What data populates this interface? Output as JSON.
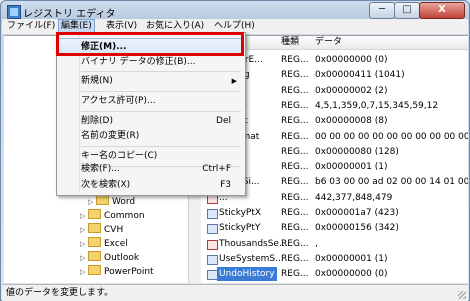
{
  "window": {
    "title": "レジストリ エディタ",
    "min_label": "─",
    "max_label": "□",
    "close_label": "X"
  },
  "menubar": {
    "items": [
      "ファイル(F)",
      "編集(E)",
      "表示(V)",
      "お気に入り(A)",
      "ヘルプ(H)"
    ]
  },
  "tree": {
    "items": [
      {
        "label": "Word",
        "expander": "▷"
      },
      {
        "label": "Common",
        "expander": "▷"
      },
      {
        "label": "CVH",
        "expander": "▷"
      },
      {
        "label": "Excel",
        "expander": "▷"
      },
      {
        "label": "Outlook",
        "expander": "▷"
      },
      {
        "label": "PowerPoint",
        "expander": "▷"
      }
    ]
  },
  "list": {
    "headers": {
      "name": "",
      "type": "種類",
      "data": "データ"
    },
    "rows": [
      {
        "name": "...aBarE...",
        "type": "REG...",
        "data": "0x00000000 (0)",
        "icon": "binary-value-icon"
      },
      {
        "name": "...Lang",
        "type": "REG...",
        "data": "0x00000411 (1041)",
        "icon": "binary-value-icon"
      },
      {
        "name": "...zed",
        "type": "REG...",
        "data": "0x00000002 (2)",
        "icon": "binary-value-icon"
      },
      {
        "name": "...ncs",
        "type": "REG...",
        "data": "4,5,1,359,0,7,15,345,59,12",
        "icon": "string-value-icon"
      },
      {
        "name": "...Cust",
        "type": "REG...",
        "data": "0x00000008 (8)",
        "icon": "binary-value-icon"
      },
      {
        "name": "...Format",
        "type": "REG...",
        "data": "00 00 00 00 00 00 00 00 00 00 00 00 00",
        "icon": "binary-value-icon"
      },
      {
        "name": "...S",
        "type": "REG...",
        "data": "0x00000080 (128)",
        "icon": "binary-value-icon"
      },
      {
        "name": "...95",
        "type": "REG...",
        "data": "0x00000001 (1)",
        "icon": "binary-value-icon"
      },
      {
        "name": "...DlgSi...",
        "type": "REG...",
        "data": "b6 03 00 00 ad 02 00 00 14 01 00 00",
        "icon": "binary-value-icon"
      },
      {
        "name": "...",
        "type": "REG...",
        "data": "442,377,848,479",
        "icon": "string-value-icon"
      },
      {
        "name": "StickyPtX",
        "type": "REG...",
        "data": "0x000001a7 (423)",
        "icon": "binary-value-icon"
      },
      {
        "name": "StickyPtY",
        "type": "REG...",
        "data": "0x00000156 (342)",
        "icon": "binary-value-icon"
      },
      {
        "name": "ThousandsSe...",
        "type": "REG...",
        "data": ",",
        "icon": "string-value-icon"
      },
      {
        "name": "UseSystemS...",
        "type": "REG...",
        "data": "0x00000001 (1)",
        "icon": "binary-value-icon"
      },
      {
        "name": "UndoHistory",
        "type": "REG...",
        "data": "0x00000000 (0)",
        "icon": "binary-value-icon"
      }
    ]
  },
  "edit_menu": {
    "items": [
      {
        "label": "修正(M)...",
        "shortcut": ""
      },
      {
        "label": "バイナリ データの修正(B)...",
        "shortcut": ""
      },
      {
        "label": "新規(N)",
        "shortcut": "",
        "submenu": "▶"
      },
      {
        "label": "アクセス許可(P)...",
        "shortcut": ""
      },
      {
        "label": "削除(D)",
        "shortcut": "Del"
      },
      {
        "label": "名前の変更(R)",
        "shortcut": ""
      },
      {
        "label": "キー名のコピー(C)",
        "shortcut": ""
      },
      {
        "label": "検索(F)...",
        "shortcut": "Ctrl+F"
      },
      {
        "label": "次を検索(X)",
        "shortcut": "F3"
      }
    ]
  },
  "status": {
    "text": "値のデータを変更します。"
  },
  "colors": {
    "highlight_box": "#e00000",
    "selection": "#3a7bd5"
  }
}
